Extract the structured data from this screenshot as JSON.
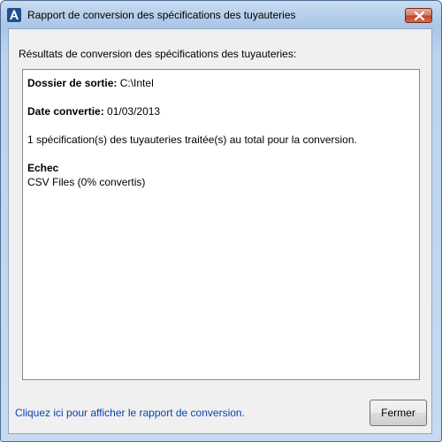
{
  "window": {
    "title": "Rapport de conversion des spécifications des tuyauteries",
    "app_icon": "autocad-plant-a-icon",
    "close_icon": "close-x-icon"
  },
  "header_label": "Résultats de conversion des spécifications des tuyauteries:",
  "report": {
    "output_folder_label": "Dossier de sortie:",
    "output_folder_value": "C:\\Intel",
    "date_label": "Date convertie:",
    "date_value": "01/03/2013",
    "summary": "1 spécification(s) des tuyauteries traitée(s) au total pour la conversion.",
    "failure_heading": "Echec",
    "failure_item": "CSV Files (0% convertis)"
  },
  "footer": {
    "link_text": "Cliquez ici pour afficher le rapport de conversion.",
    "close_button_label": "Fermer"
  },
  "colors": {
    "title_bar": "#b9d1ec",
    "link": "#0645ad",
    "close_button": "#c2442a"
  }
}
